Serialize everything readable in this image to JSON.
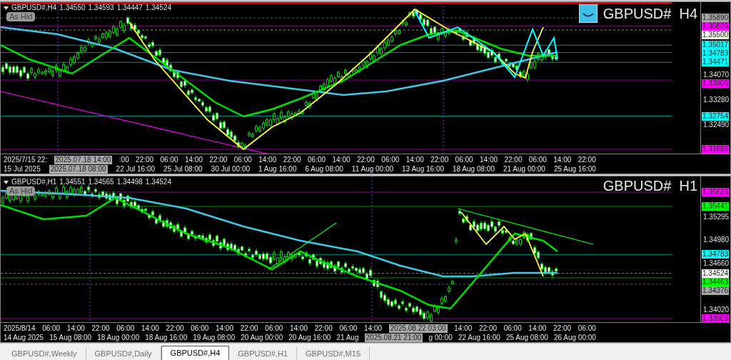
{
  "charts": [
    {
      "symbol": "GBPUSD#,H4",
      "quotes": [
        "1.34550",
        "1.34593",
        "1.34447",
        "1.34524"
      ],
      "hide_button": "As Hid",
      "title": "GBPUSD#  H4",
      "show_badge": true,
      "price_labels": [
        {
          "text": "1.35890",
          "kind": "tag",
          "color": "#a8a8a8"
        },
        {
          "text": "1.35636",
          "kind": "tag",
          "color": "#ff00ff"
        },
        {
          "text": "1.35500",
          "kind": "tag",
          "color": "#fffff0"
        },
        {
          "text": "1.35017",
          "kind": "tag",
          "color": "#00ffff"
        },
        {
          "text": "1.34783",
          "kind": "tag",
          "color": "#00ffff"
        },
        {
          "text": "1.34471",
          "kind": "tag",
          "color": "#00ffff"
        },
        {
          "text": "1.34070",
          "kind": "tick"
        },
        {
          "text": "1.33906",
          "kind": "tag",
          "color": "#ff00ff"
        },
        {
          "text": "1.33280",
          "kind": "tick"
        },
        {
          "text": "1.32754",
          "kind": "tag",
          "color": "#00ffff"
        },
        {
          "text": "1.32490",
          "kind": "tick"
        },
        {
          "text": "1.31696",
          "kind": "tag",
          "color": "#ff00ff"
        }
      ],
      "time_rows": [
        [
          {
            "text": "2025/7/15 22:"
          },
          {
            "text": "2025.07.18 14:00",
            "kind": "cursor"
          },
          {
            "text": ":00"
          },
          {
            "text": "22:00"
          },
          {
            "text": "06:00"
          },
          {
            "text": "14:00"
          },
          {
            "text": "22:00"
          },
          {
            "text": "06:00"
          },
          {
            "text": "14:00"
          },
          {
            "text": "22:00"
          },
          {
            "text": "06:00"
          },
          {
            "text": "14:00"
          },
          {
            "text": "22:00"
          },
          {
            "text": "06:00"
          },
          {
            "text": "14:00"
          },
          {
            "text": "22:00"
          },
          {
            "text": "06:00"
          },
          {
            "text": "14:00"
          },
          {
            "text": "22:00"
          },
          {
            "text": "06:00"
          },
          {
            "text": "14:00"
          },
          {
            "text": "22:00"
          }
        ],
        [
          {
            "text": "15 Jul 2025"
          },
          {
            "text": "2025.07.18 08:00",
            "kind": "cursor"
          },
          {
            "text": "22 Jul 16:00"
          },
          {
            "text": "25 Jul 08:00"
          },
          {
            "text": "30 Jul 00:00"
          },
          {
            "text": "1 Aug 16:00"
          },
          {
            "text": "6 Aug 08:00"
          },
          {
            "text": "11 Aug 00:00"
          },
          {
            "text": "13 Aug 16:00"
          },
          {
            "text": "18 Aug 08:00"
          },
          {
            "text": "21 Aug 00:00"
          },
          {
            "text": "25 Aug 16:00"
          }
        ]
      ]
    },
    {
      "symbol": "GBPUSD#,H1",
      "quotes": [
        "1.34551",
        "1.34565",
        "1.34498",
        "1.34524"
      ],
      "hide_button": "As Hid",
      "title": "GBPUSD#  H1",
      "show_badge": false,
      "price_labels": [
        {
          "text": "1.35636",
          "kind": "tag",
          "color": "#ff00ff"
        },
        {
          "text": "1.35441",
          "kind": "tag",
          "color": "#00ff00"
        },
        {
          "text": "1.35295",
          "kind": "tick"
        },
        {
          "text": "1.34980",
          "kind": "tick"
        },
        {
          "text": "1.34783",
          "kind": "tag",
          "color": "#00ffff"
        },
        {
          "text": "1.34660",
          "kind": "tick"
        },
        {
          "text": "1.34524",
          "kind": "tag",
          "color": "#ffffff"
        },
        {
          "text": "1.34463",
          "kind": "tag",
          "color": "#00ff00"
        },
        {
          "text": "1.34376",
          "kind": "tag",
          "color": "#a8a8a8"
        },
        {
          "text": "1.34020",
          "kind": "tick"
        },
        {
          "text": "1.33906",
          "kind": "tag",
          "color": "#ff00ff"
        }
      ],
      "time_rows": [
        [
          {
            "text": "2025/8/14"
          },
          {
            "text": "06:00"
          },
          {
            "text": "14:00"
          },
          {
            "text": "22:00"
          },
          {
            "text": "06:00"
          },
          {
            "text": "14:00"
          },
          {
            "text": "22:00"
          },
          {
            "text": "06:00"
          },
          {
            "text": "14:00"
          },
          {
            "text": "22:00"
          },
          {
            "text": "06:00"
          },
          {
            "text": "14:00"
          },
          {
            "text": "22:00"
          },
          {
            "text": "06:00"
          },
          {
            "text": "14:00"
          },
          {
            "text": "2025.08.22 03:00",
            "kind": "cursor"
          },
          {
            "text": "14:00"
          },
          {
            "text": "22:00"
          },
          {
            "text": "06:00"
          },
          {
            "text": "14:00"
          },
          {
            "text": "22:00"
          },
          {
            "text": "06:00"
          }
        ],
        [
          {
            "text": "14 Aug 2025"
          },
          {
            "text": "15 Aug 08:00"
          },
          {
            "text": "18 Aug 00:00"
          },
          {
            "text": "18 Aug 16:00"
          },
          {
            "text": "19 Aug 08:00"
          },
          {
            "text": "20 Aug 00:00"
          },
          {
            "text": "20 Aug 16:00"
          },
          {
            "text": "21 Aug"
          },
          {
            "text": "2025.08.21 21:00",
            "kind": "cursor"
          },
          {
            "text": "g 00:00"
          },
          {
            "text": "22 Aug 16:00"
          },
          {
            "text": "25 Aug 08:00"
          },
          {
            "text": "26 Aug 00:00"
          }
        ]
      ]
    }
  ],
  "tabs": [
    {
      "label": "GBPUSD#,Weekly",
      "selected": false
    },
    {
      "label": "GBPUSD#,Daily",
      "selected": false
    },
    {
      "label": "GBPUSD#,H4",
      "selected": true
    },
    {
      "label": "GBPUSD#,H1",
      "selected": false
    },
    {
      "label": "GBPUSD#,M15",
      "selected": false
    }
  ]
}
